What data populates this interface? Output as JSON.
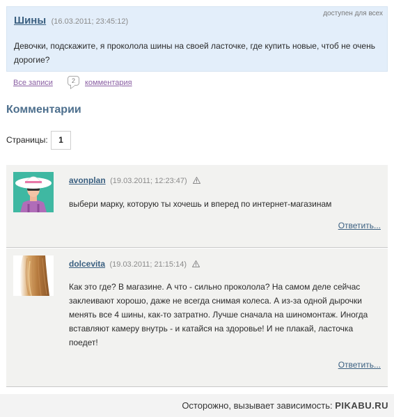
{
  "post": {
    "title": "Шины",
    "date": "(16.03.2011; 23:45:12)",
    "access": "доступен для всех",
    "text": "Девочки, подскажите, я проколола шины на своей ласточке, где купить новые, чтоб не очень дорогие?"
  },
  "links": {
    "all_posts": "Все записи",
    "comment_count": "2",
    "comments": "комментария"
  },
  "comments_section": {
    "title": "Комментарии",
    "pages_label": "Страницы:",
    "current_page": "1"
  },
  "comments": [
    {
      "author": "avonplan",
      "date": "(19.03.2011; 12:23:47)",
      "text": "выбери марку, которую ты хочешь и вперед по интернет-магазинам",
      "reply": "Ответить...",
      "avatar_icon": "woman-in-hat-icon"
    },
    {
      "author": "dolcevita",
      "date": "(19.03.2011; 21:15:14)",
      "text": "Как это где? В магазине. А что - сильно проколола? На самом деле сейчас заклеивают хорошо, даже не всегда снимая колеса. А из-за одной дырочки менять все 4 шины, как-то затратно. Лучше сначала на шиномонтаж. Иногда вставляют камеру внутрь -  и катайся на здоровье! И не плакай,  ласточка поедет!",
      "reply": "Ответить...",
      "avatar_icon": "blonde-hair-icon"
    }
  ],
  "footer": {
    "text": "Осторожно, вызывает зависимость:",
    "brand": "PIKABU.RU"
  },
  "colors": {
    "post_bg": "#e3eefa",
    "comment_bg": "#f2f2f0",
    "link_blue": "#3a5f80",
    "link_purple": "#8a5fa3"
  }
}
